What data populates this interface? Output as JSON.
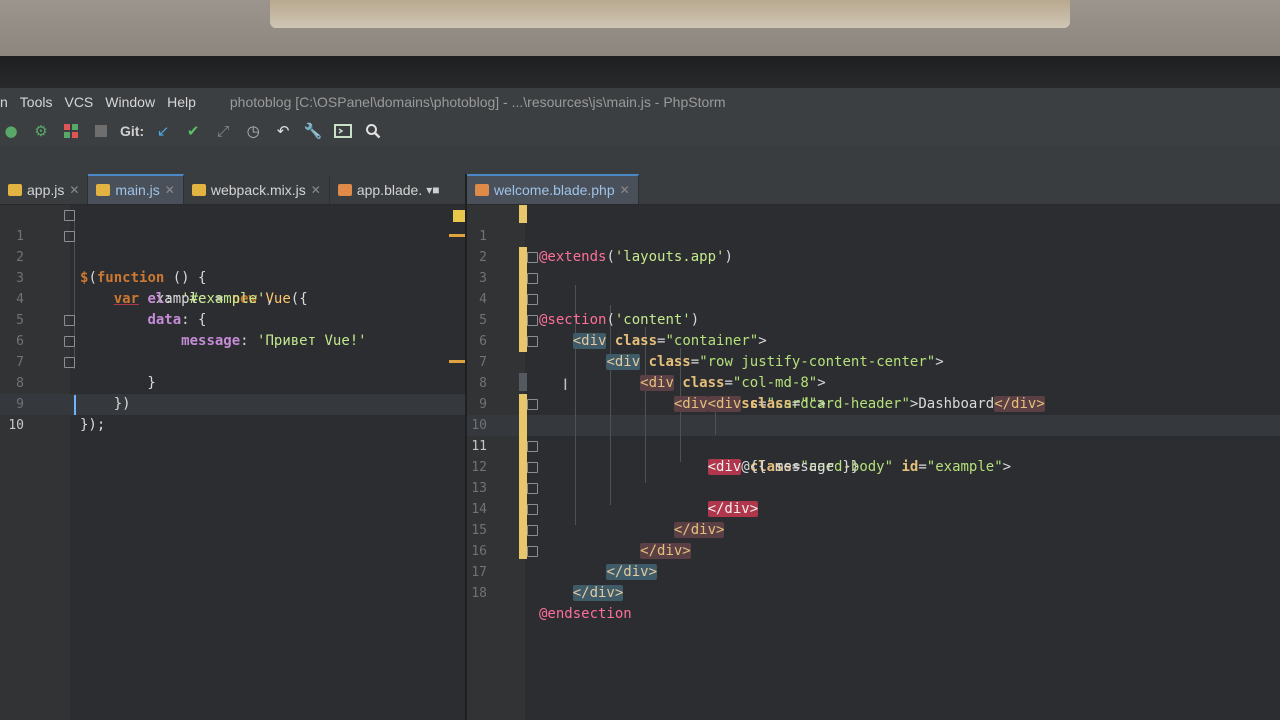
{
  "menubar": {
    "items": [
      "n",
      "Tools",
      "VCS",
      "Window",
      "Help"
    ],
    "window_title": "photoblog [C:\\OSPanel\\domains\\photoblog] - ...\\resources\\js\\main.js - PhpStorm"
  },
  "toolbar": {
    "git_label": "Git:",
    "icons": [
      "run-icon",
      "debug-icon",
      "coverage-icon",
      "stop-icon",
      "vcs-update-icon",
      "vcs-commit-icon",
      "vcs-push-icon",
      "history-icon",
      "revert-icon",
      "settings-wrench-icon",
      "terminal-icon",
      "search-icon"
    ]
  },
  "left_tabs": [
    {
      "label": "app.js",
      "active": false
    },
    {
      "label": "main.js",
      "active": true
    },
    {
      "label": "webpack.mix.js",
      "active": false
    },
    {
      "label": "app.blade.",
      "active": false
    }
  ],
  "right_tabs": [
    {
      "label": "welcome.blade.php",
      "active": true
    }
  ],
  "left_editor": {
    "current_line": 10,
    "lines": [
      {
        "n": "1",
        "code": "$(function () {"
      },
      {
        "n": "2",
        "code": "    var example = new Vue({"
      },
      {
        "n": "3",
        "code": "        el: '#example',"
      },
      {
        "n": "4",
        "code": "        data: {"
      },
      {
        "n": "5",
        "code": "            message: 'Привет Vue!'"
      },
      {
        "n": "6",
        "code": "        }"
      },
      {
        "n": "7",
        "code": "    })"
      },
      {
        "n": "8",
        "code": "});"
      },
      {
        "n": "9",
        "code": ""
      },
      {
        "n": "10",
        "code": ""
      }
    ]
  },
  "right_editor": {
    "current_line": 11,
    "lines": [
      {
        "n": "1",
        "code": "@extends('layouts.app')"
      },
      {
        "n": "2",
        "code": ""
      },
      {
        "n": "3",
        "code": "@section('content')"
      },
      {
        "n": "4",
        "code": "    <div class=\"container\">"
      },
      {
        "n": "5",
        "code": "        <div class=\"row justify-content-center\">"
      },
      {
        "n": "6",
        "code": "            <div class=\"col-md-8\">"
      },
      {
        "n": "7",
        "code": "                <div class=\"card\">"
      },
      {
        "n": "8",
        "code": "                    <div class=\"card-header\">Dashboard</div>"
      },
      {
        "n": "9",
        "code": ""
      },
      {
        "n": "10",
        "code": "                    <div class=\"card-body\" id=\"example\">"
      },
      {
        "n": "11",
        "code": "                        @{{ message }}"
      },
      {
        "n": "12",
        "code": "                    </div>"
      },
      {
        "n": "13",
        "code": "                </div>"
      },
      {
        "n": "14",
        "code": "            </div>"
      },
      {
        "n": "15",
        "code": "        </div>"
      },
      {
        "n": "16",
        "code": "    </div>"
      },
      {
        "n": "17",
        "code": "@endsection"
      },
      {
        "n": "18",
        "code": ""
      }
    ]
  },
  "colors": {
    "keyword": "#cc7832",
    "string": "#c4e88d",
    "property": "#c58bd6",
    "tag_highlight": "#b0364b",
    "blade_directive": "#ff9a4d",
    "active_tab": "#4a88c7"
  }
}
